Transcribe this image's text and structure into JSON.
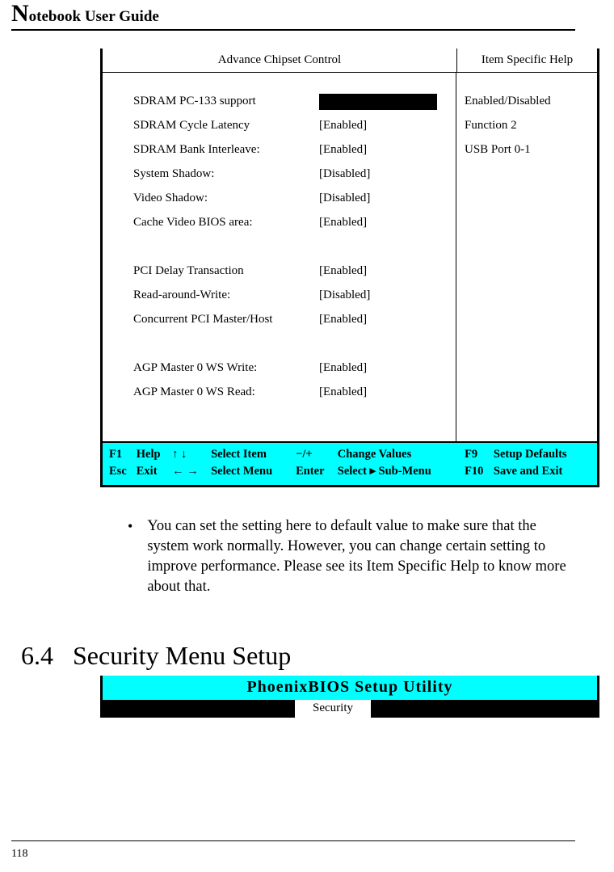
{
  "running_head": {
    "big": "N",
    "rest": "otebook User Guide"
  },
  "page_number": "118",
  "bios": {
    "header": {
      "left": "Advance Chipset Control",
      "right": "Item Specific Help"
    },
    "settings_groups": [
      [
        {
          "label": "SDRAM PC-133 support",
          "value": ""
        },
        {
          "label": "SDRAM Cycle Latency",
          "value": "[Enabled]"
        },
        {
          "label": "SDRAM Bank Interleave:",
          "value": "[Enabled]"
        },
        {
          "label": "System Shadow:",
          "value": "[Disabled]"
        },
        {
          "label": "Video Shadow:",
          "value": "[Disabled]"
        },
        {
          "label": "Cache Video BIOS area:",
          "value": "[Enabled]"
        }
      ],
      [
        {
          "label": "PCI Delay Transaction",
          "value": "[Enabled]"
        },
        {
          "label": "Read-around-Write:",
          "value": "[Disabled]"
        },
        {
          "label": "Concurrent PCI Master/Host",
          "value": "[Enabled]"
        }
      ],
      [
        {
          "label": "AGP Master 0 WS Write:",
          "value": "[Enabled]"
        },
        {
          "label": "AGP Master 0 WS Read:",
          "value": "[Enabled]"
        }
      ]
    ],
    "help_lines": [
      "Enabled/Disabled",
      "Function 2",
      "USB Port 0-1"
    ],
    "footer": {
      "row1": {
        "k1": "F1",
        "l1": "Help",
        "k2": "↑ ↓",
        "l2": "Select Item",
        "k3": "−/+",
        "l3": "Change Values",
        "k4": "F9",
        "l4": "Setup Defaults"
      },
      "row2": {
        "k1": "Esc",
        "l1": "Exit",
        "k2": "← →",
        "l2": "Select Menu",
        "k3": "Enter",
        "l3": "Select  ▸ Sub-Menu",
        "k4": "F10",
        "l4": "Save and Exit"
      }
    }
  },
  "body_bullet": "You can set the setting here to default value to make sure that the system work normally. However, you can change certain setting to improve performance. Please see its Item Specific Help to know more about that.",
  "section": {
    "number": "6.4",
    "title": "Security Menu Setup"
  },
  "phoenix": {
    "title": "PhoenixBIOS Setup Utility",
    "active_tab": "Security"
  }
}
